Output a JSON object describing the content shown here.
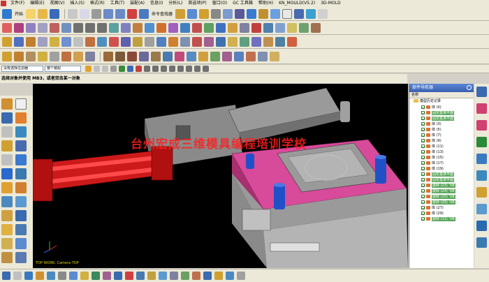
{
  "menu": {
    "items": [
      "文件(F)",
      "编辑(E)",
      "视图(V)",
      "插入(S)",
      "格式(R)",
      "工具(T)",
      "装配(A)",
      "信息(I)",
      "分析(L)",
      "首选项(P)",
      "窗口(O)",
      "GC 工具箱",
      "帮助(H)",
      "KN_MOULD(V5.2)",
      "3D-MOLD"
    ]
  },
  "toolbar": {
    "start_label": "开始",
    "command_finder_label": "命令查找器"
  },
  "selection_bar": {
    "filter_value": "没有选择过滤器",
    "scope_value": "整个装配"
  },
  "prompt": {
    "text": "选择对象并使用 MB3，或者双击某一对象"
  },
  "viewport": {
    "watermark": "台州宏成三维模具编程培训学校",
    "view_label": "TOP WORK: Camera TOP",
    "colors": {
      "background": "#000000",
      "mold_pink": "#d84a9a",
      "cylinder_red": "#e02020",
      "body_grey": "#9a9a9a",
      "pillar_blue": "#2050c8"
    }
  },
  "navigator": {
    "title": "部件导航器",
    "column_header": "名称",
    "root_label": "模型历史记录",
    "rows": [
      {
        "label": "体 (0)",
        "highlight": false
      },
      {
        "label": "固定基准平面",
        "highlight": true
      },
      {
        "label": "固定基准平面",
        "highlight": true
      },
      {
        "label": "体 (3)",
        "highlight": false
      },
      {
        "label": "体 (5)",
        "highlight": false
      },
      {
        "label": "体 (7)",
        "highlight": false
      },
      {
        "label": "体 (9)",
        "highlight": false
      },
      {
        "label": "体 (11)",
        "highlight": false
      },
      {
        "label": "体 (13)",
        "highlight": false
      },
      {
        "label": "体 (15)",
        "highlight": false
      },
      {
        "label": "体 (17)",
        "highlight": false
      },
      {
        "label": "体 (19)",
        "highlight": false
      },
      {
        "label": "固定基准平面",
        "highlight": true
      },
      {
        "label": "固定基准平面",
        "highlight": true
      },
      {
        "label": "旋转 (23) 'VB",
        "highlight": true
      },
      {
        "label": "旋转 (24) 'VB",
        "highlight": true
      },
      {
        "label": "旋转 (25) 'VB",
        "highlight": true
      },
      {
        "label": "旋转 (26) 'VB",
        "highlight": true
      },
      {
        "label": "体 (27)",
        "highlight": false
      },
      {
        "label": "体 (29)",
        "highlight": false
      },
      {
        "label": "旋转 (31) 'VB",
        "highlight": true
      }
    ]
  }
}
